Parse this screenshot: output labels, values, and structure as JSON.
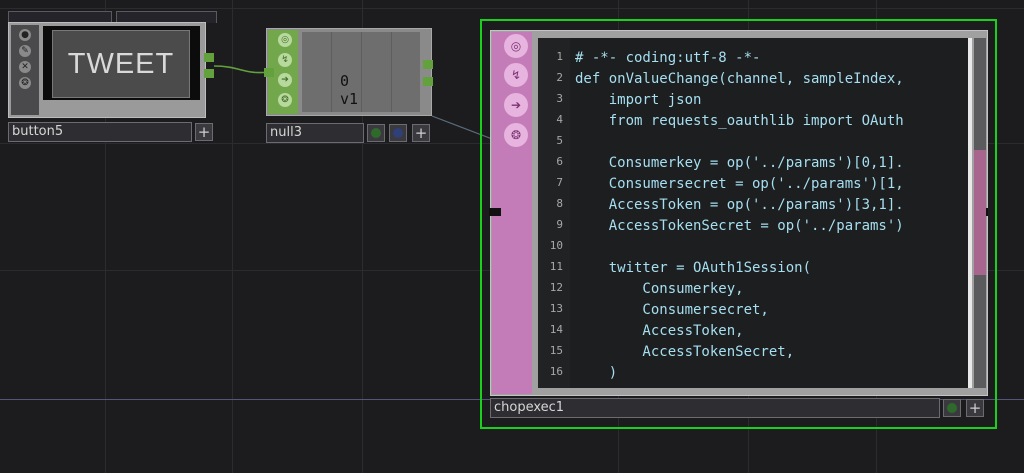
{
  "button5": {
    "name": "button5",
    "button_label": "TWEET",
    "side_icons": [
      "●",
      "✎",
      "✕",
      "❂"
    ]
  },
  "null3": {
    "name": "null3",
    "value_text": "0 v1",
    "side_icons": [
      "◎",
      "↯",
      "➔",
      "❂"
    ]
  },
  "chopexec1": {
    "name": "chopexec1",
    "side_icons": [
      "◎",
      "↯",
      "➔",
      "❂"
    ],
    "code_lines": [
      {
        "n": "1",
        "text": "# -*- coding:utf-8 -*-"
      },
      {
        "n": "2",
        "text": "def onValueChange(channel, sampleIndex,"
      },
      {
        "n": "3",
        "text": "    import json"
      },
      {
        "n": "4",
        "text": "    from requests_oauthlib import OAuth"
      },
      {
        "n": "5",
        "text": ""
      },
      {
        "n": "6",
        "text": "    Consumerkey = op('../params')[0,1]."
      },
      {
        "n": "7",
        "text": "    Consumersecret = op('../params')[1,"
      },
      {
        "n": "8",
        "text": "    AccessToken = op('../params')[3,1]."
      },
      {
        "n": "9",
        "text": "    AccessTokenSecret = op('../params')"
      },
      {
        "n": "10",
        "text": ""
      },
      {
        "n": "11",
        "text": "    twitter = OAuth1Session("
      },
      {
        "n": "12",
        "text": "        Consumerkey,"
      },
      {
        "n": "13",
        "text": "        Consumersecret,"
      },
      {
        "n": "14",
        "text": "        AccessToken,"
      },
      {
        "n": "15",
        "text": "        AccessTokenSecret,"
      },
      {
        "n": "16",
        "text": "    )"
      }
    ]
  },
  "node_controls": {
    "plus_glyph": "+"
  },
  "colors": {
    "background": "#1c1c1f",
    "selection": "#19d11a",
    "wire": "#62a13b",
    "chop_family": "#c47cb9",
    "null_family": "#72a84b"
  }
}
